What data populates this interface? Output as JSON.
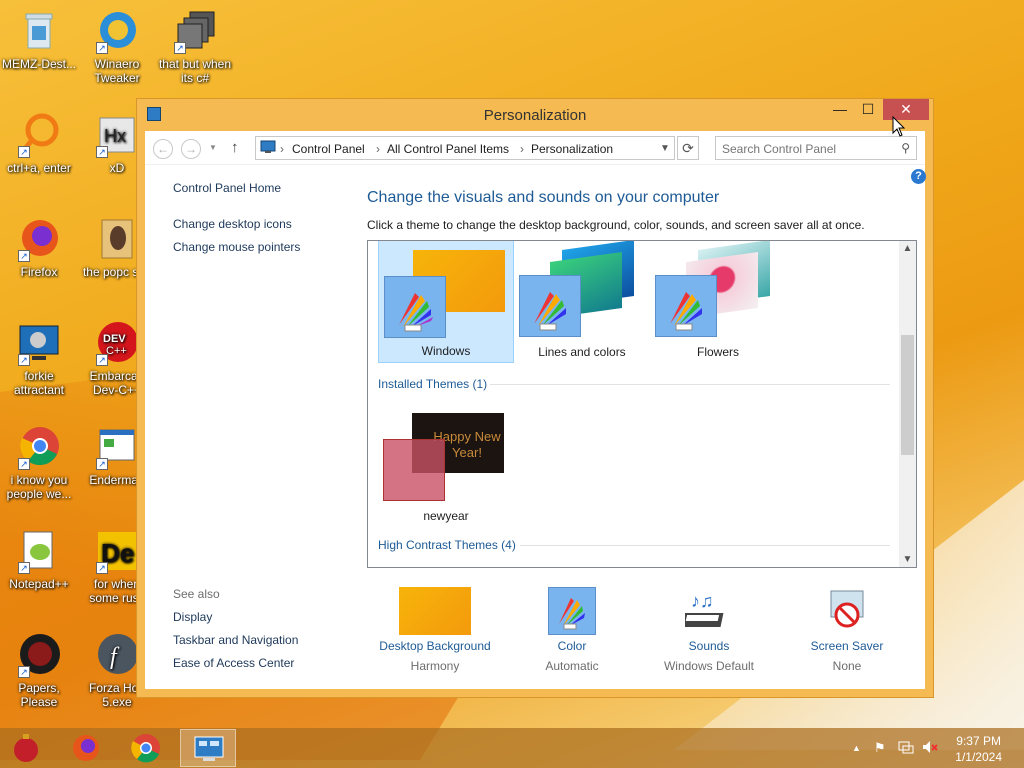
{
  "desktop": {
    "icons": [
      {
        "label": "MEMZ-Dest..."
      },
      {
        "label": "Winaero Tweaker"
      },
      {
        "label": "that but when its c#"
      },
      {
        "label": "ctrl+a, enter"
      },
      {
        "label": "xD"
      },
      {
        "label": "Firefox"
      },
      {
        "label": "the popc shit"
      },
      {
        "label": "forkie attractant"
      },
      {
        "label": "Embarcad Dev-C++"
      },
      {
        "label": "i know you people we..."
      },
      {
        "label": "Enderman"
      },
      {
        "label": "Notepad++"
      },
      {
        "label": "for when some russ"
      },
      {
        "label": "Papers, Please"
      },
      {
        "label": "Forza Hori 5.exe"
      }
    ]
  },
  "window": {
    "title": "Personalization",
    "minimize": "—",
    "maximize": "☐",
    "close": "✕"
  },
  "navbar": {
    "back": "←",
    "forward": "→",
    "up": "↑",
    "breadcrumb": [
      "Control Panel",
      "All Control Panel Items",
      "Personalization"
    ],
    "search_placeholder": "Search Control Panel"
  },
  "sidebar": {
    "home": "Control Panel Home",
    "links": [
      "Change desktop icons",
      "Change mouse pointers"
    ],
    "see_also_title": "See also",
    "see_also": [
      "Display",
      "Taskbar and Navigation",
      "Ease of Access Center"
    ]
  },
  "main": {
    "heading": "Change the visuals and sounds on your computer",
    "subheading": "Click a theme to change the desktop background, color, sounds, and screen saver all at once.",
    "help": "?",
    "default_themes": [
      {
        "label": "Windows",
        "selected": true
      },
      {
        "label": "Lines and colors",
        "selected": false
      },
      {
        "label": "Flowers",
        "selected": false
      }
    ],
    "installed_header": "Installed Themes (1)",
    "installed_themes": [
      {
        "label": "newyear",
        "preview_text": "Happy New Year!"
      }
    ],
    "high_contrast_header": "High Contrast Themes (4)"
  },
  "bottom": [
    {
      "name": "Desktop Background",
      "value": "Harmony"
    },
    {
      "name": "Color",
      "value": "Automatic"
    },
    {
      "name": "Sounds",
      "value": "Windows Default"
    },
    {
      "name": "Screen Saver",
      "value": "None"
    }
  ],
  "taskbar": {
    "time": "9:37 PM",
    "date": "1/1/2024",
    "tray_arrow": "▲"
  },
  "colors": {
    "accent": "#1e5b96",
    "window_frame": "#f5bb52",
    "close": "#c75050"
  }
}
